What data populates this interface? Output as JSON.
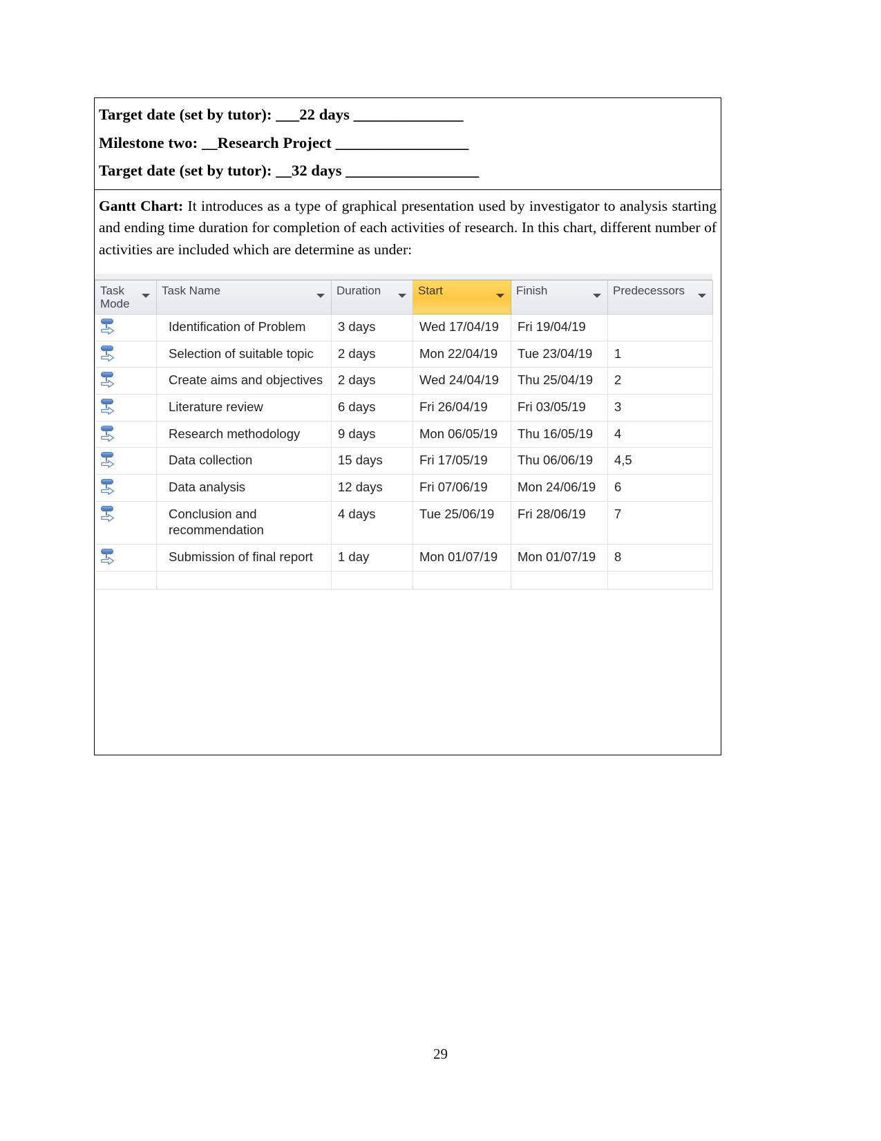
{
  "document": {
    "page_number": "29",
    "milestone_lines": [
      "Target date (set by tutor):  ___22 days ______________",
      "Milestone two: __Research Project _________________",
      "Target date (set by tutor): __32 days _________________"
    ],
    "gantt_section": {
      "lead_label": "Gantt Chart:",
      "body": " It introduces as a type of graphical presentation used by investigator to analysis starting and ending time duration for completion of each activities of research. In this chart, different number of activities are included which are determine as under:"
    }
  },
  "project_table": {
    "sorted_column": "Start",
    "sorted_header_color": "#ffc843",
    "header_color": "#e6e8ec",
    "icon_color": "#5a86c4",
    "columns": [
      {
        "label": "Task Mode",
        "has_filter": true
      },
      {
        "label": "Task Name",
        "has_filter": true
      },
      {
        "label": "Duration",
        "has_filter": true
      },
      {
        "label": "Start",
        "has_filter": true
      },
      {
        "label": "Finish",
        "has_filter": true
      },
      {
        "label": "Predecessors",
        "has_filter": true
      }
    ],
    "rows": [
      {
        "mode_icon": "auto-schedule-icon",
        "name": "Identification of Problem",
        "duration": "3 days",
        "start": "Wed 17/04/19",
        "finish": "Fri 19/04/19",
        "predecessors": ""
      },
      {
        "mode_icon": "auto-schedule-icon",
        "name": "Selection of suitable topic",
        "duration": "2 days",
        "start": "Mon 22/04/19",
        "finish": "Tue 23/04/19",
        "predecessors": "1"
      },
      {
        "mode_icon": "auto-schedule-icon",
        "name": "Create aims and objectives",
        "duration": "2 days",
        "start": "Wed 24/04/19",
        "finish": "Thu 25/04/19",
        "predecessors": "2"
      },
      {
        "mode_icon": "auto-schedule-icon",
        "name": "Literature review",
        "duration": "6 days",
        "start": "Fri 26/04/19",
        "finish": "Fri 03/05/19",
        "predecessors": "3"
      },
      {
        "mode_icon": "auto-schedule-icon",
        "name": "Research methodology",
        "duration": "9 days",
        "start": "Mon 06/05/19",
        "finish": "Thu 16/05/19",
        "predecessors": "4"
      },
      {
        "mode_icon": "auto-schedule-icon",
        "name": "Data collection",
        "duration": "15 days",
        "start": "Fri 17/05/19",
        "finish": "Thu 06/06/19",
        "predecessors": "4,5"
      },
      {
        "mode_icon": "auto-schedule-icon",
        "name": "Data analysis",
        "duration": "12 days",
        "start": "Fri 07/06/19",
        "finish": "Mon 24/06/19",
        "predecessors": "6"
      },
      {
        "mode_icon": "auto-schedule-icon",
        "name": "Conclusion and recommendation",
        "duration": "4 days",
        "start": "Tue 25/06/19",
        "finish": "Fri 28/06/19",
        "predecessors": "7"
      },
      {
        "mode_icon": "auto-schedule-icon",
        "name": "Submission of final report",
        "duration": "1 day",
        "start": "Mon 01/07/19",
        "finish": "Mon 01/07/19",
        "predecessors": "8"
      }
    ]
  }
}
